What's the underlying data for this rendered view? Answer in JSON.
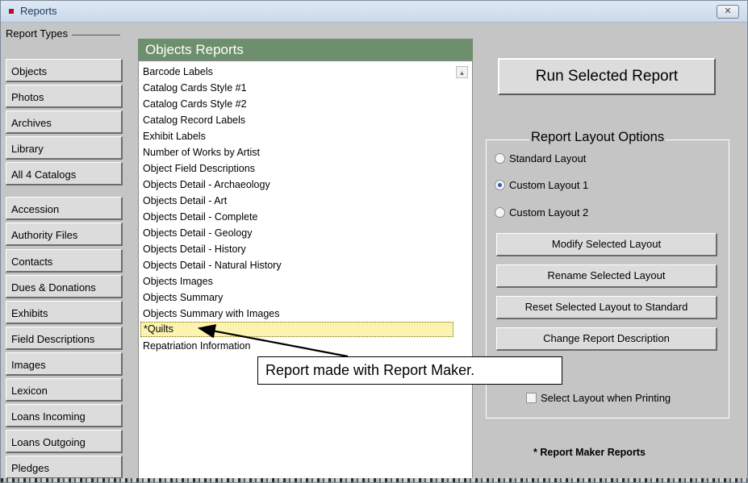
{
  "window": {
    "title": "Reports",
    "close_label": "✕"
  },
  "sidebar": {
    "label": "Report Types",
    "items": [
      "Objects",
      "Photos",
      "Archives",
      "Library",
      "All 4 Catalogs",
      "Accession",
      "Authority Files",
      "Contacts",
      "Dues & Donations",
      "Exhibits",
      "Field Descriptions",
      "Images",
      "Lexicon",
      "Loans Incoming",
      "Loans Outgoing",
      "Pledges"
    ]
  },
  "report_list": {
    "header": "Objects Reports",
    "items": [
      "Barcode Labels",
      "Catalog Cards Style #1",
      "Catalog Cards Style #2",
      "Catalog Record Labels",
      "Exhibit Labels",
      "Number of Works by Artist",
      "Object Field Descriptions",
      "Objects Detail - Archaeology",
      "Objects Detail - Art",
      "Objects Detail - Complete",
      "Objects Detail - Geology",
      "Objects Detail - History",
      "Objects Detail - Natural History",
      "Objects Images",
      "Objects Summary",
      "Objects Summary with Images",
      "*Quilts",
      "Repatriation Information"
    ],
    "selected": "*Quilts"
  },
  "run_button": "Run Selected Report",
  "layout_options": {
    "title": "Report Layout Options",
    "radios": [
      {
        "label": "Standard Layout",
        "checked": false
      },
      {
        "label": "Custom Layout 1",
        "checked": true
      },
      {
        "label": "Custom Layout 2",
        "checked": false
      }
    ],
    "buttons": [
      "Modify Selected Layout",
      "Rename Selected Layout",
      "Reset Selected Layout to Standard",
      "Change Report Description"
    ],
    "checkbox_label": "Select Layout when Printing",
    "checkbox_checked": false
  },
  "note": "* Report Maker Reports",
  "callout": "Report made with Report Maker.",
  "colors": {
    "list_header": "#6e8f6e",
    "selection": "#fdf3b0",
    "title_icon": "#b3102a"
  }
}
